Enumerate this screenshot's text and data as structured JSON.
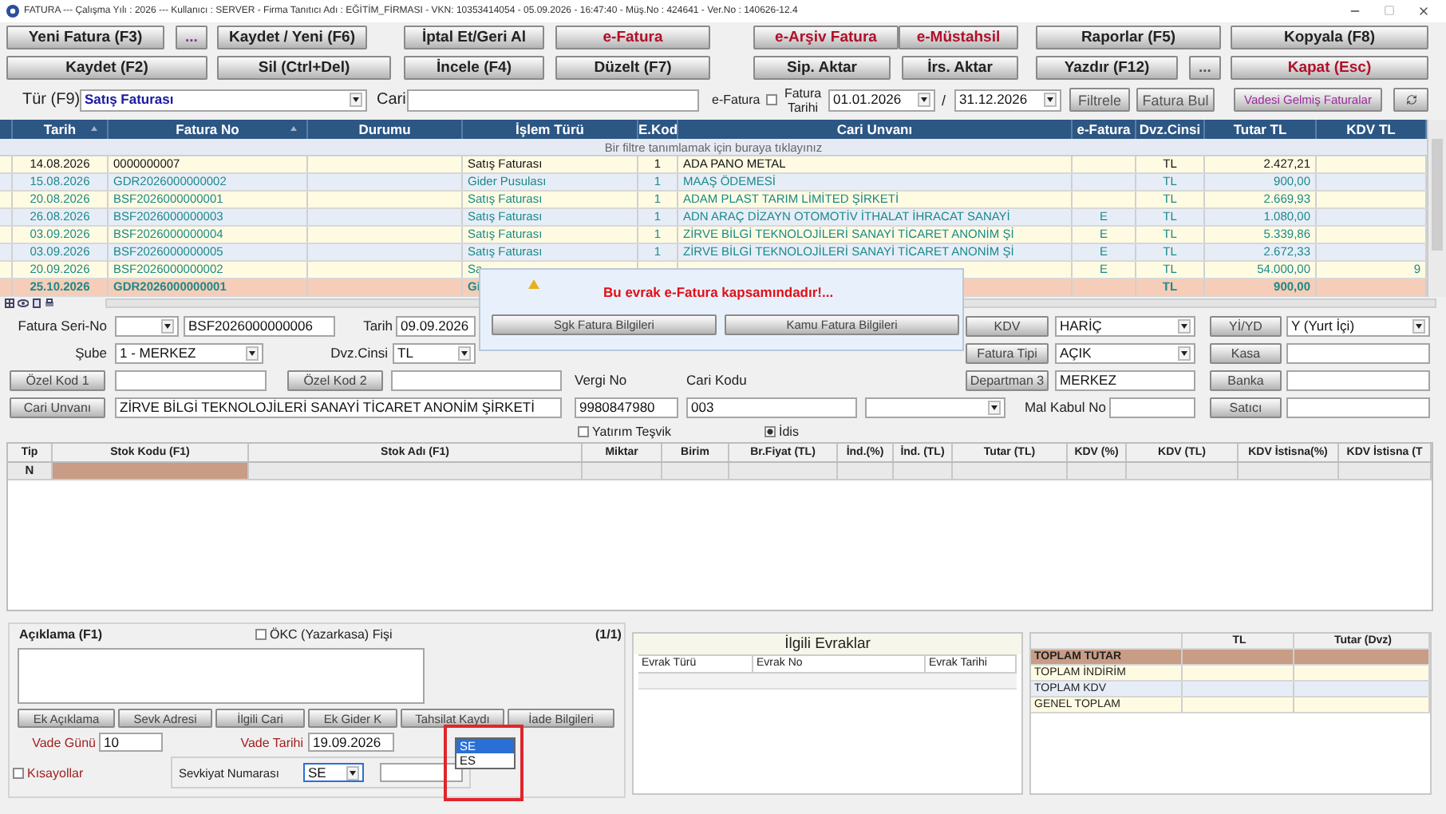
{
  "window": {
    "title": "FATURA  ---  Çalışma Yılı : 2026  ---  Kullanıcı : SERVER - Firma Tanıtıcı Adı : EĞİTİM_FİRMASI - VKN: 10353414054 - 05.09.2026 - 16:47:40 - Müş.No : 424641 - Ver.No : 140626-12.4"
  },
  "toolbar": [
    [
      {
        "label": "Yeni Fatura (F3)",
        "color": "#222222"
      },
      {
        "label": "...",
        "color": "#8a2a9a"
      },
      {
        "label": "Kaydet / Yeni (F6)",
        "color": "#222222"
      },
      {
        "label": "İptal Et/Geri Al",
        "color": "#222222"
      },
      {
        "label": "e-Fatura",
        "color": "#b0102a"
      },
      {
        "label": "e-Arşiv Fatura",
        "color": "#b0102a"
      },
      {
        "label": "e-Müstahsil",
        "color": "#b0102a"
      },
      {
        "label": "Raporlar (F5)",
        "color": "#222222"
      },
      {
        "label": "Kopyala (F8)",
        "color": "#222222"
      }
    ],
    [
      {
        "label": "Kaydet (F2)",
        "color": "#222222"
      },
      {
        "label": "Sil (Ctrl+Del)",
        "color": "#222222"
      },
      {
        "label": "İncele (F4)",
        "color": "#222222"
      },
      {
        "label": "Düzelt (F7)",
        "color": "#222222"
      },
      {
        "label": "Sip. Aktar",
        "color": "#222222"
      },
      {
        "label": "İrs. Aktar",
        "color": "#222222"
      },
      {
        "label": "Yazdır (F12)",
        "color": "#222222"
      },
      {
        "label": "...",
        "color": "#555555"
      },
      {
        "label": "Kapat (Esc)",
        "color": "#b0102a"
      }
    ]
  ],
  "filter": {
    "type": {
      "label": "Tür (F9)",
      "value": "Satış Faturası"
    },
    "cari": {
      "label": "Cari"
    },
    "efatura": {
      "label": "e-Fatura",
      "checked": false
    },
    "date": {
      "label": "Fatura Tarihi",
      "from": "01.01.2026",
      "separator": "/",
      "to": "31.12.2026"
    },
    "buttons": [
      {
        "label": "Filtrele",
        "color": "#555555"
      },
      {
        "label": "Fatura Bul",
        "color": "#555555"
      },
      {
        "label": "Vadesi Gelmiş Faturalar",
        "color": "#9a2a9a"
      }
    ]
  },
  "invoice_table": {
    "columns": [
      {
        "label": "Tarih",
        "sortable": true
      },
      {
        "label": "Fatura No",
        "sortable": true
      },
      {
        "label": "Durumu",
        "sortable": false
      },
      {
        "label": "İşlem Türü",
        "sortable": false
      },
      {
        "label": "E.Kod",
        "sortable": false
      },
      {
        "label": "Cari Unvanı",
        "sortable": false
      },
      {
        "label": "e-Fatura",
        "sortable": false
      },
      {
        "label": "Dvz.Cinsi",
        "sortable": false
      },
      {
        "label": "Tutar TL",
        "sortable": false
      },
      {
        "label": "KDV TL",
        "sortable": false
      }
    ],
    "filter_hint": "Bir filtre tanımlamak için buraya tıklayınız",
    "rows": [
      {
        "cells": [
          "14.08.2026",
          "0000000007",
          "",
          "Satış Faturası",
          "1",
          "ADA PANO METAL",
          "",
          "TL",
          "2.427,21",
          ""
        ],
        "color": "#111111",
        "selected": false
      },
      {
        "cells": [
          "15.08.2026",
          "GDR2026000000002",
          "",
          "Gider Pusulası",
          "1",
          "MAAŞ ÖDEMESİ",
          "",
          "TL",
          "900,00",
          ""
        ],
        "color": "#1a8a8a",
        "selected": false
      },
      {
        "cells": [
          "20.08.2026",
          "BSF2026000000001",
          "",
          "Satış Faturası",
          "1",
          "ADAM PLAST TARIM LİMİTED ŞİRKETİ",
          "",
          "TL",
          "2.669,93",
          ""
        ],
        "color": "#1a8a8a",
        "selected": false
      },
      {
        "cells": [
          "26.08.2026",
          "BSF2026000000003",
          "",
          "Satış Faturası",
          "1",
          "ADN ARAÇ DİZAYN OTOMOTİV İTHALAT İHRACAT SANAYİ",
          "E",
          "TL",
          "1.080,00",
          ""
        ],
        "color": "#1a8a8a",
        "selected": false
      },
      {
        "cells": [
          "03.09.2026",
          "BSF2026000000004",
          "",
          "Satış Faturası",
          "1",
          "ZİRVE BİLGİ TEKNOLOJİLERİ SANAYİ TİCARET ANONİM Şİ",
          "E",
          "TL",
          "5.339,86",
          ""
        ],
        "color": "#1a8a8a",
        "selected": false
      },
      {
        "cells": [
          "03.09.2026",
          "BSF2026000000005",
          "",
          "Satış Faturası",
          "1",
          "ZİRVE BİLGİ TEKNOLOJİLERİ SANAYİ TİCARET ANONİM Şİ",
          "E",
          "TL",
          "2.672,33",
          ""
        ],
        "color": "#1a8a8a",
        "selected": false
      },
      {
        "cells": [
          "20.09.2026",
          "BSF2026000000002",
          "",
          "Sa",
          "",
          "",
          "E",
          "TL",
          "54.000,00",
          "9"
        ],
        "color": "#1a8a8a",
        "selected": false
      },
      {
        "cells": [
          "25.10.2026",
          "GDR2026000000001",
          "",
          "Gi",
          "",
          "",
          "",
          "TL",
          "900,00",
          ""
        ],
        "color": "#1a8a8a",
        "selected": true
      }
    ]
  },
  "notice": {
    "message": "Bu evrak e-Fatura kapsamındadır!...",
    "buttons": [
      "Sgk Fatura Bilgileri",
      "Kamu Fatura Bilgileri"
    ]
  },
  "form": {
    "lines": [
      {
        "items": [
          {
            "kind": "label",
            "text": "Fatura Seri-No"
          },
          {
            "kind": "select"
          },
          {
            "kind": "field",
            "value": "BSF2026000000006"
          },
          {
            "kind": "label",
            "text": "Tarih"
          },
          {
            "kind": "field",
            "value": "09.09.2026"
          },
          {
            "kind": "button",
            "label": "KDV"
          },
          {
            "kind": "select",
            "value": "HARİÇ"
          },
          {
            "kind": "button",
            "label": "Yİ/YD"
          },
          {
            "kind": "select",
            "value": "Y (Yurt İçi)"
          }
        ]
      },
      {
        "items": [
          {
            "kind": "label",
            "text": "Şube"
          },
          {
            "kind": "select",
            "value": "1 - MERKEZ"
          },
          {
            "kind": "label",
            "text": "Dvz.Cinsi"
          },
          {
            "kind": "select",
            "value": "TL"
          },
          {
            "kind": "button",
            "label": "Fatura Tipi"
          },
          {
            "kind": "select",
            "value": "AÇIK"
          },
          {
            "kind": "button",
            "label": "Kasa"
          },
          {
            "kind": "field"
          }
        ]
      },
      {
        "items": [
          {
            "kind": "button",
            "label": "Özel Kod 1"
          },
          {
            "kind": "field"
          },
          {
            "kind": "button",
            "label": "Özel Kod 2"
          },
          {
            "kind": "field"
          },
          {
            "kind": "label",
            "text": "Vergi No"
          },
          {
            "kind": "label",
            "text": "Cari Kodu"
          },
          {
            "kind": "button",
            "label": "Departman 3"
          },
          {
            "kind": "field",
            "value": "MERKEZ"
          },
          {
            "kind": "button",
            "label": "Banka"
          },
          {
            "kind": "field"
          }
        ]
      },
      {
        "items": [
          {
            "kind": "button",
            "label": "Cari Unvanı"
          },
          {
            "kind": "field",
            "value": "ZİRVE BİLGİ TEKNOLOJİLERİ SANAYİ TİCARET ANONİM ŞİRKETİ"
          },
          {
            "kind": "field",
            "value": "9980847980"
          },
          {
            "kind": "field",
            "value": "003"
          },
          {
            "kind": "select"
          },
          {
            "kind": "label",
            "text": "Mal Kabul No"
          },
          {
            "kind": "field"
          },
          {
            "kind": "button",
            "label": "Satıcı"
          },
          {
            "kind": "field"
          }
        ]
      }
    ],
    "options": [
      {
        "label": "Yatırım Teşvik",
        "checked": false
      },
      {
        "label": "İdis",
        "checked": true
      }
    ]
  },
  "items_table": {
    "columns": [
      "Tip",
      "Stok Kodu (F1)",
      "Stok Adı (F1)",
      "Miktar",
      "Birim",
      "Br.Fiyat (TL)",
      "İnd.(%)",
      "İnd. (TL)",
      "Tutar (TL)",
      "KDV (%)",
      "KDV (TL)",
      "KDV İstisna(%)",
      "KDV İstisna (T"
    ],
    "rows": [
      {
        "cells": [
          "N"
        ],
        "selected": true
      }
    ]
  },
  "notes": {
    "label": "Açıklama (F1)",
    "okc": {
      "label": "ÖKC (Yazarkasa) Fişi",
      "checked": false
    },
    "page": "(1/1)",
    "buttons": [
      "Ek Açıklama",
      "Sevk Adresi",
      "İlgili Cari",
      "Ek Gider K",
      "Tahsilat Kaydı",
      "İade Bilgileri"
    ],
    "vade_gunu": {
      "label": "Vade Günü",
      "value": "10"
    },
    "vade_tarihi": {
      "label": "Vade Tarihi",
      "value": "19.09.2026"
    },
    "shortcuts": {
      "label": "Kısayollar",
      "checked": false
    },
    "shipment": {
      "label": "Sevkiyat Numarası",
      "value": "SE",
      "expanded": true,
      "options": [
        {
          "label": "SE",
          "selected": true
        },
        {
          "label": "ES",
          "selected": false
        }
      ]
    }
  },
  "related_docs": {
    "title": "İlgili Evraklar",
    "columns": [
      "Evrak Türü",
      "Evrak No",
      "Evrak Tarihi"
    ]
  },
  "totals": {
    "columns": [
      "TL",
      "Tutar (Dvz)"
    ],
    "rows": [
      {
        "label": "TOPLAM TUTAR",
        "selected": true
      },
      {
        "label": "TOPLAM İNDİRİM",
        "selected": false
      },
      {
        "label": "TOPLAM KDV",
        "selected": false
      },
      {
        "label": "GENEL TOPLAM",
        "selected": false
      }
    ]
  }
}
